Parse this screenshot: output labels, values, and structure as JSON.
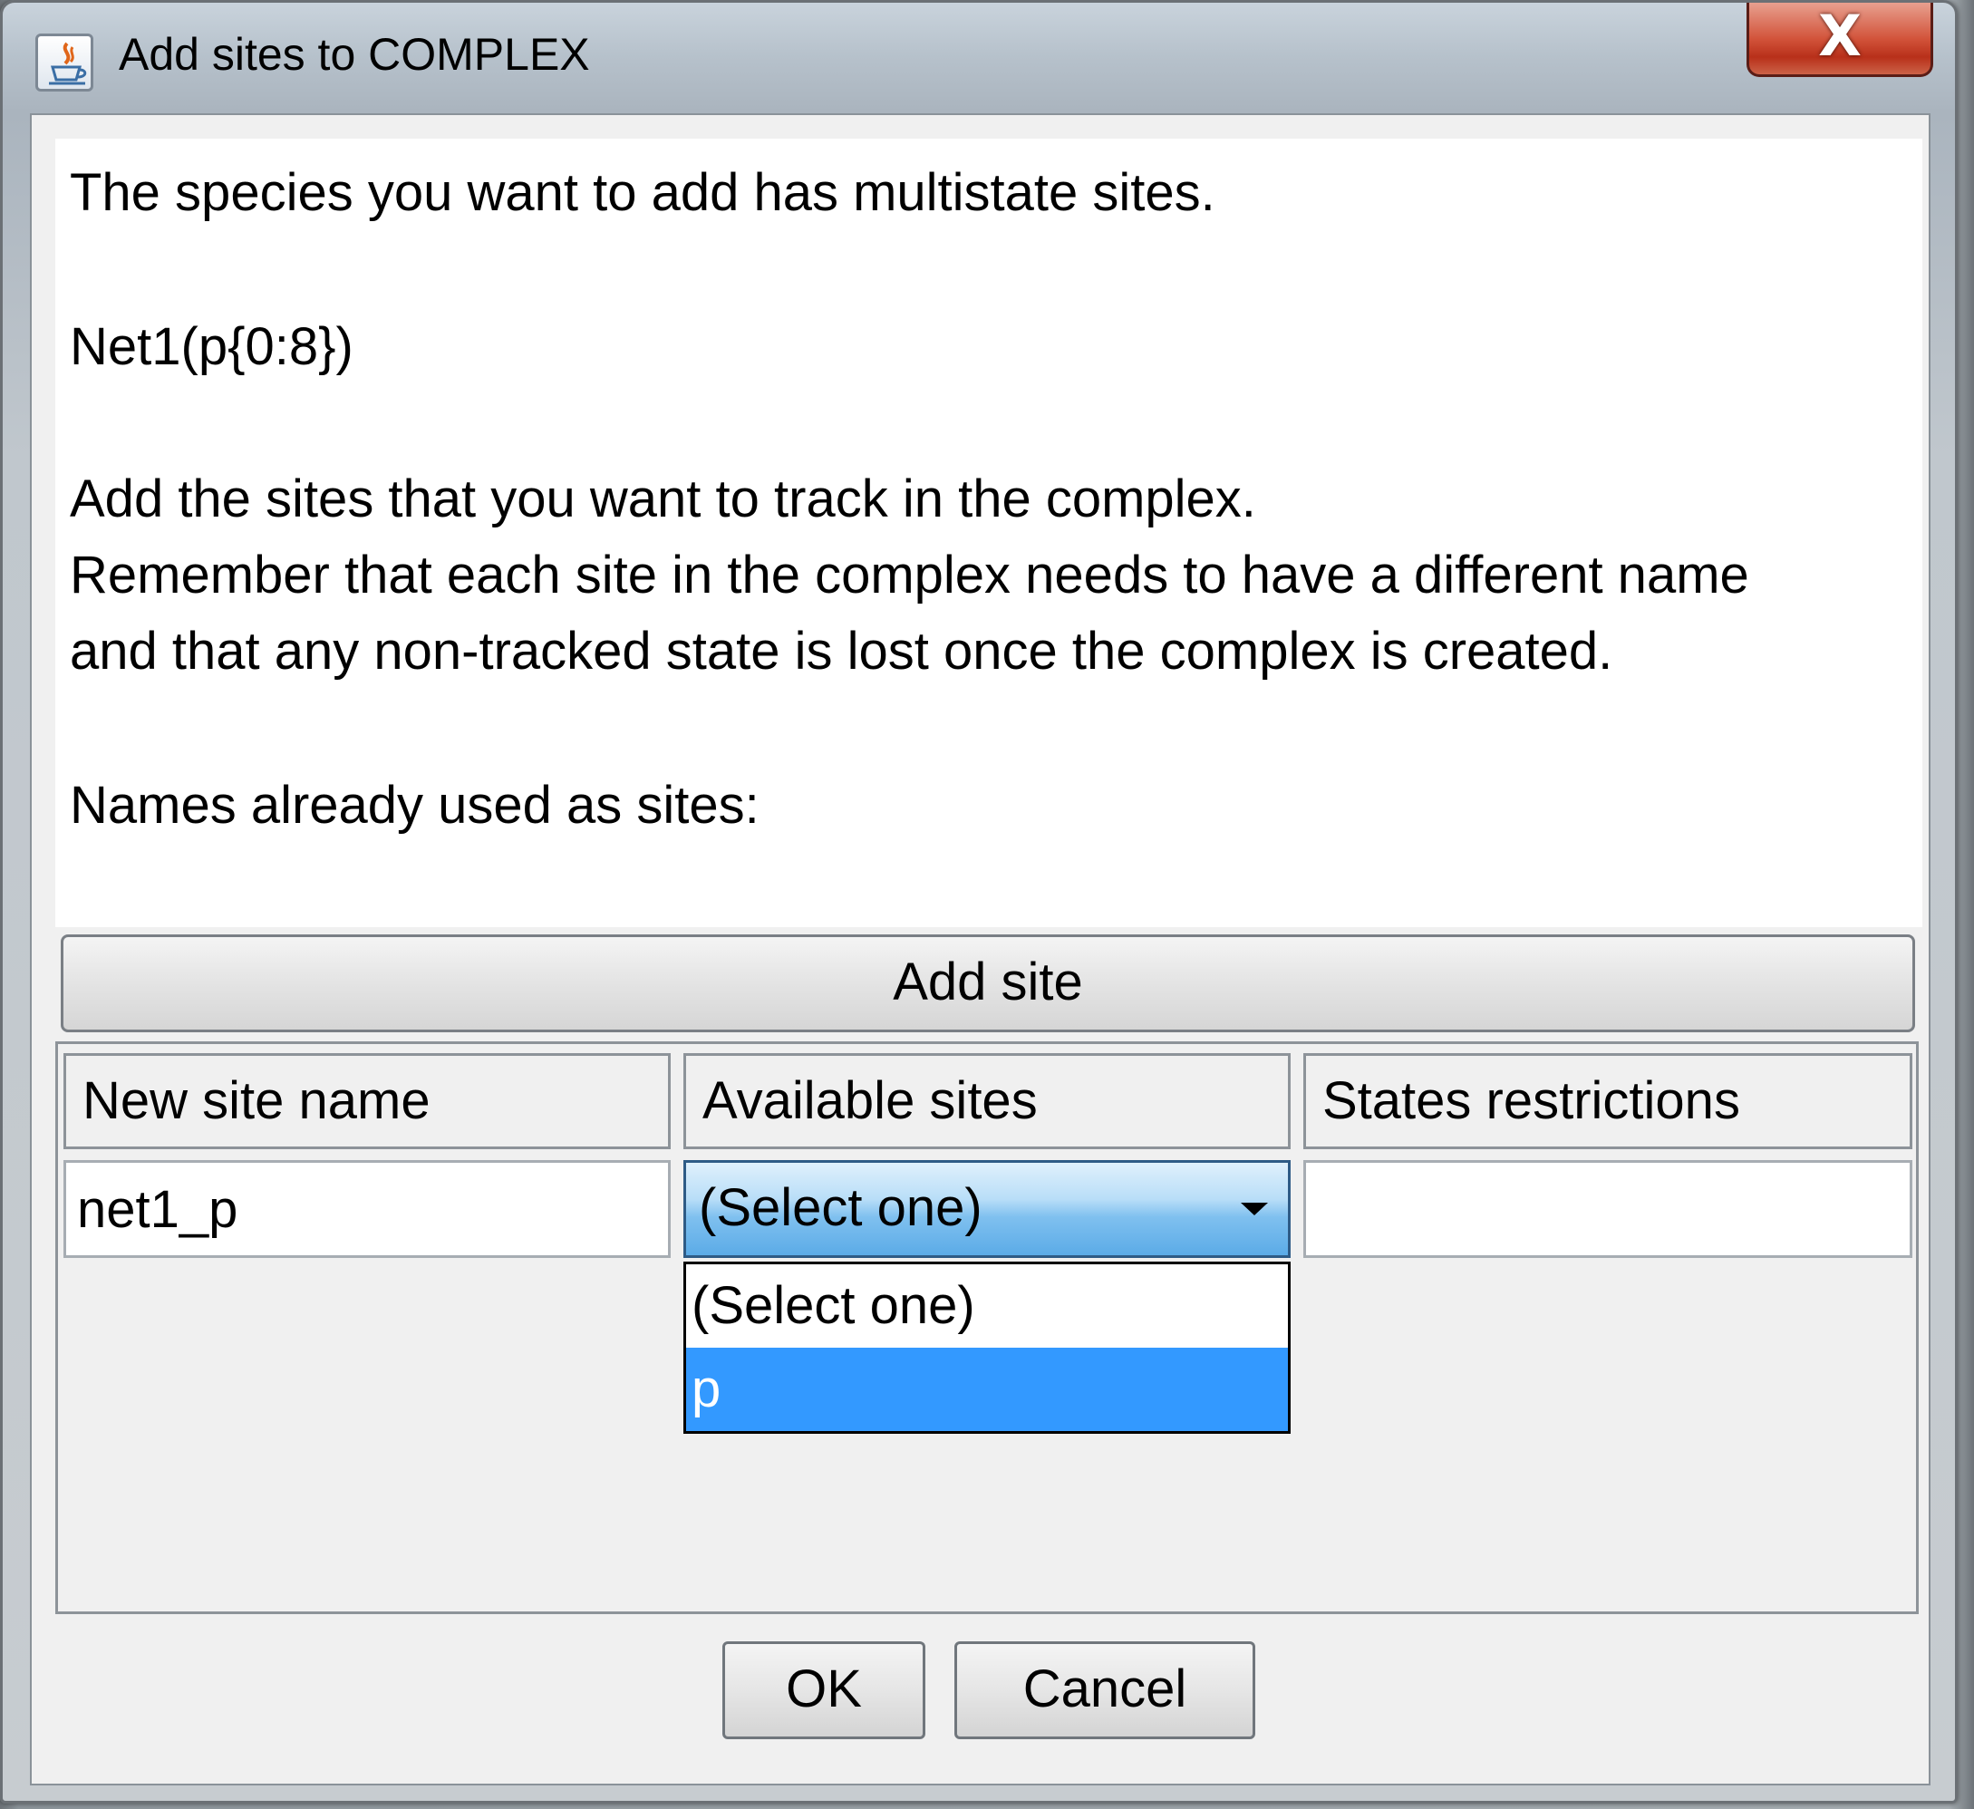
{
  "window": {
    "title": "Add sites to COMPLEX",
    "close_label": "X"
  },
  "message": {
    "line1": "The species you want to add has multistate sites.",
    "species": "Net1(p{0:8})",
    "line3": "Add the sites that you want to track in the complex.",
    "line4": "Remember that each site in the complex needs to have a different name",
    "line5": "and that any non-tracked state is lost once the complex is created.",
    "line6": "Names already used as sites:"
  },
  "add_site_label": "Add site",
  "table": {
    "headers": [
      "New site name",
      "Available sites",
      "States restrictions"
    ],
    "row": {
      "new_site_name": "net1_p",
      "available_site_selected": "(Select one)",
      "states_restrictions": ""
    },
    "dropdown_options": [
      "(Select one)",
      "p"
    ],
    "dropdown_highlighted": "p"
  },
  "buttons": {
    "ok": "OK",
    "cancel": "Cancel"
  },
  "colors": {
    "selection": "#3399ff",
    "close_button": "#c7432a"
  },
  "icons": {
    "title": "java-cup-icon",
    "dropdown": "chevron-down-icon"
  }
}
